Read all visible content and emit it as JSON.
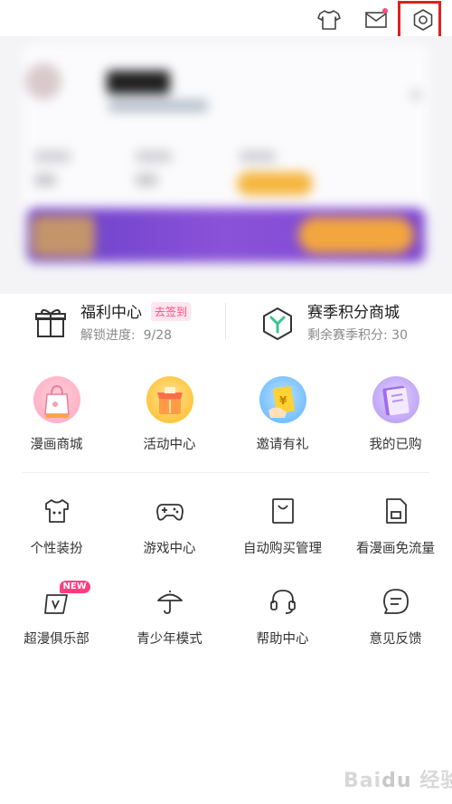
{
  "top_bar": {
    "icons": [
      "shirt-icon",
      "mail-icon",
      "settings-icon"
    ],
    "mail_has_notification": true,
    "highlight_color": "#e02020"
  },
  "welfare": {
    "left": {
      "title": "福利中心",
      "badge": "去签到",
      "progress_label": "解锁进度:",
      "progress_value": "9/28"
    },
    "right": {
      "title": "赛季积分商城",
      "subtitle": "剩余赛季积分: 30"
    }
  },
  "feature_grid": [
    {
      "label": "漫画商城",
      "icon": "comic-shop-icon"
    },
    {
      "label": "活动中心",
      "icon": "activity-center-icon"
    },
    {
      "label": "邀请有礼",
      "icon": "invite-gift-icon"
    },
    {
      "label": "我的已购",
      "icon": "purchased-icon"
    }
  ],
  "service_grid_1": [
    {
      "label": "个性装扮",
      "icon": "dress-up-icon"
    },
    {
      "label": "游戏中心",
      "icon": "gamepad-icon"
    },
    {
      "label": "自动购买管理",
      "icon": "shopping-bag-icon"
    },
    {
      "label": "看漫画免流量",
      "icon": "sim-card-icon"
    }
  ],
  "service_grid_2": [
    {
      "label": "超漫俱乐部",
      "icon": "vip-club-icon",
      "badge": "NEW"
    },
    {
      "label": "青少年模式",
      "icon": "umbrella-icon"
    },
    {
      "label": "帮助中心",
      "icon": "headset-icon"
    },
    {
      "label": "意见反馈",
      "icon": "feedback-icon"
    }
  ],
  "colors": {
    "accent_pink": "#ff4b7d",
    "badge_bg": "#ffe6ee",
    "text_primary": "#1c1c1c",
    "text_secondary": "#8a8a8a"
  }
}
